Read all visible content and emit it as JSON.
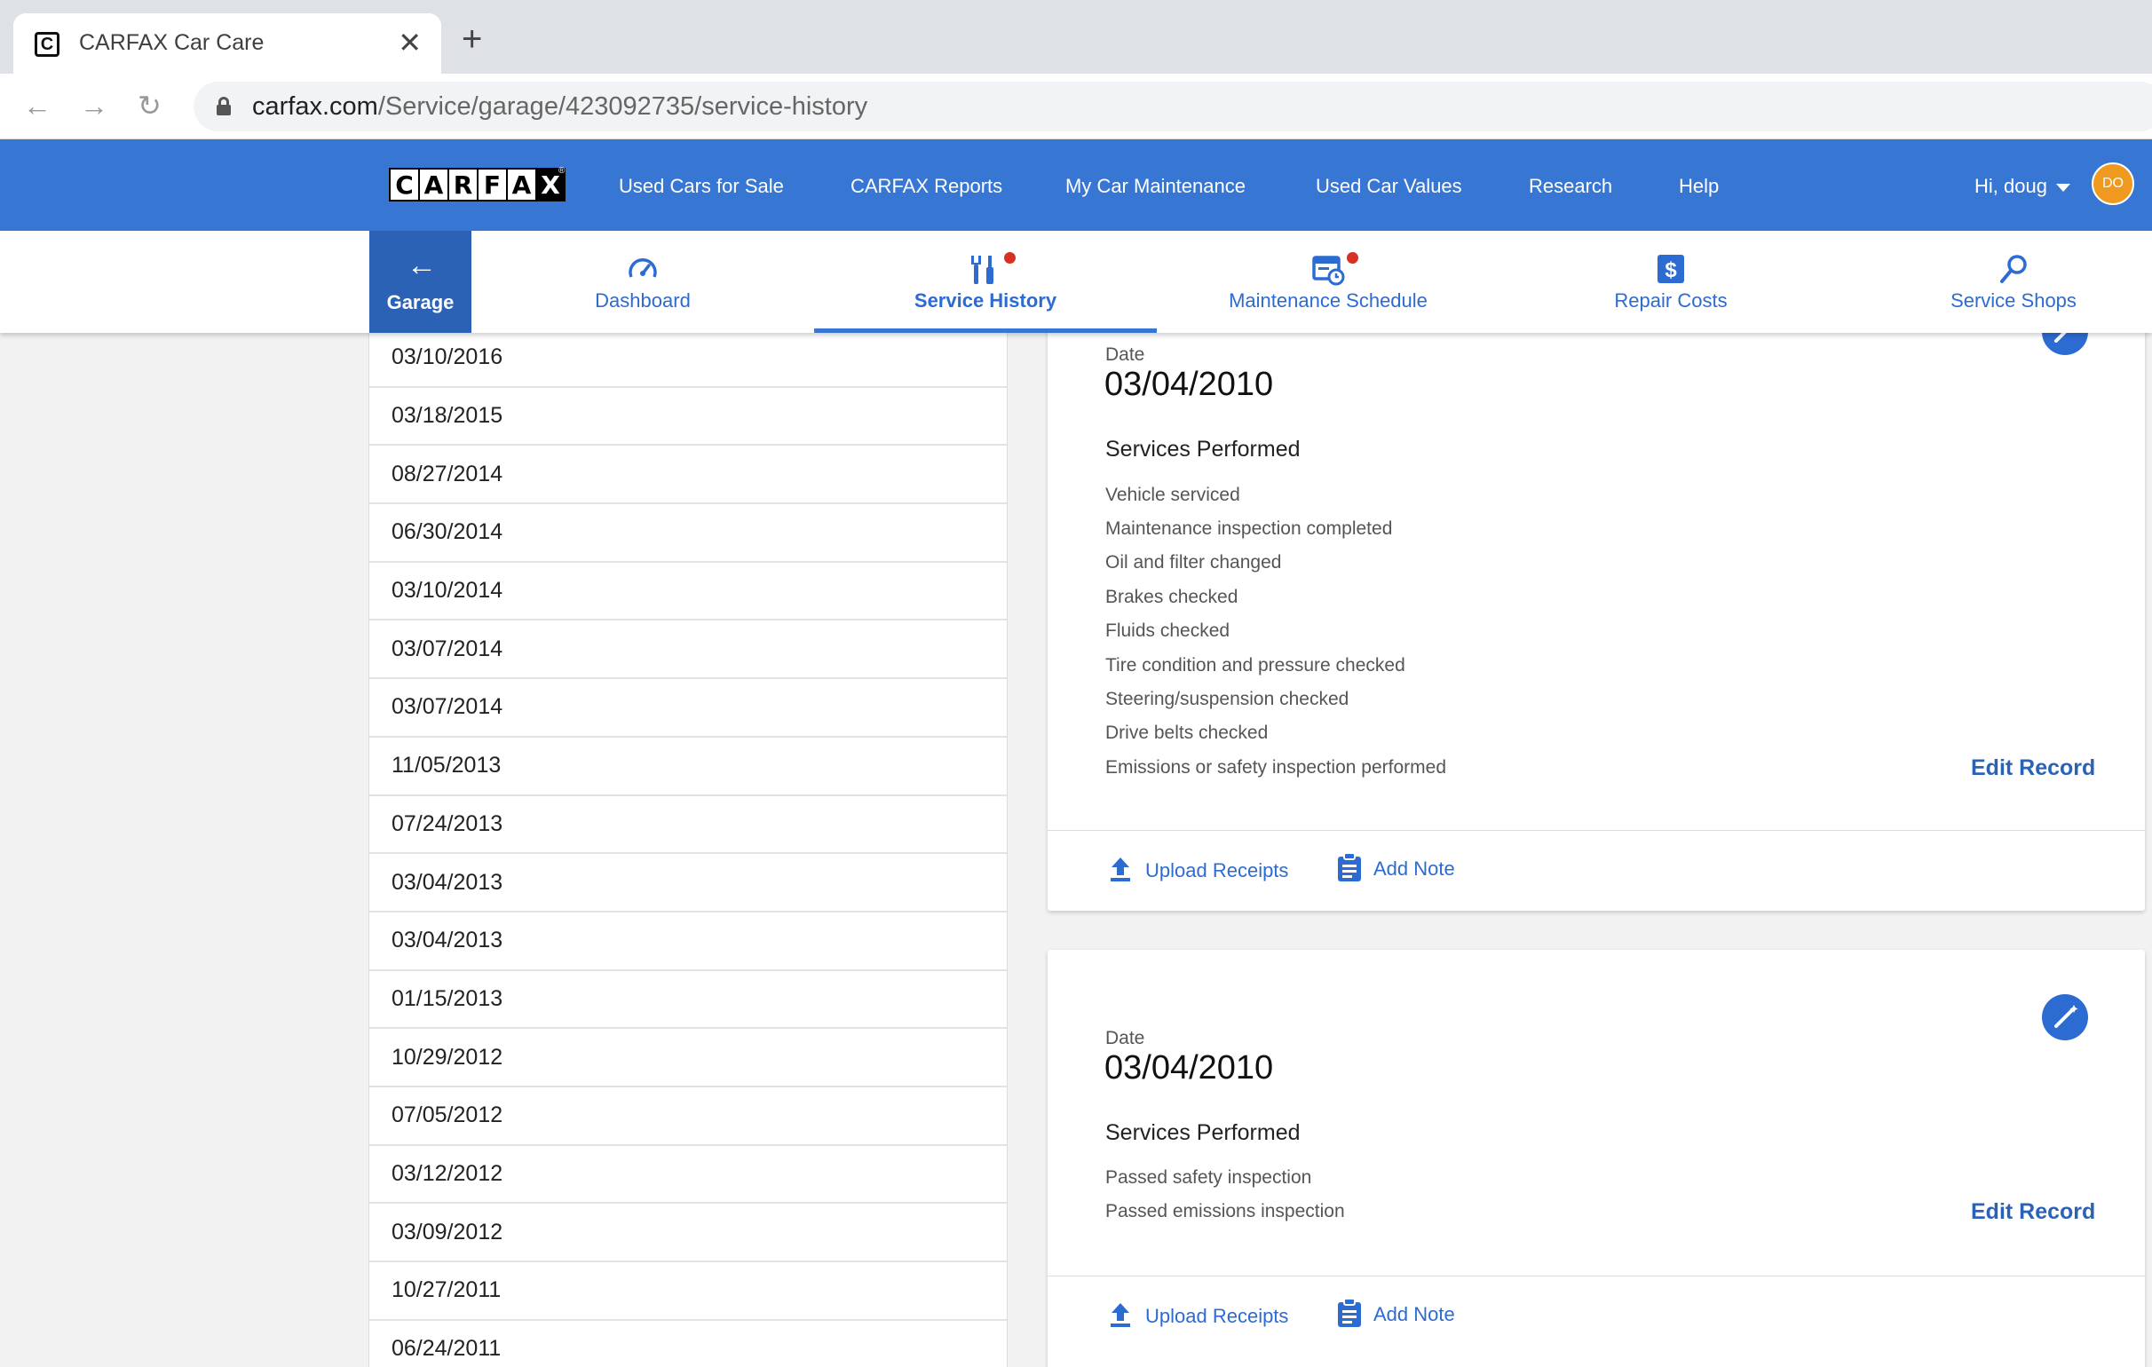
{
  "browser": {
    "tab_title": "CARFAX Car Care",
    "favicon_letter": "C",
    "tab_close": "✕",
    "new_tab": "+",
    "url_host": "carfax.com",
    "url_path": "/Service/garage/423092735/service-history",
    "back": "←",
    "forward": "→",
    "reload": "↻"
  },
  "header": {
    "logo_letters": [
      "C",
      "A",
      "R",
      "F",
      "A",
      "X"
    ],
    "logo_reg": "®",
    "nav": [
      "Used Cars for Sale",
      "CARFAX Reports",
      "My Car Maintenance",
      "Used Car Values",
      "Research",
      "Help"
    ],
    "greeting": "Hi, doug",
    "avatar_initials": "DO"
  },
  "subnav": {
    "garage_arrow": "←",
    "garage_label": "Garage",
    "items": [
      {
        "label": "Dashboard",
        "icon": "speedometer-icon",
        "active": false,
        "badge": false
      },
      {
        "label": "Service History",
        "icon": "wrench-icon",
        "active": true,
        "badge": true
      },
      {
        "label": "Maintenance Schedule",
        "icon": "calendar-clock-icon",
        "active": false,
        "badge": true
      },
      {
        "label": "Repair Costs",
        "icon": "dollar-icon",
        "active": false,
        "badge": false
      },
      {
        "label": "Service Shops",
        "icon": "search-icon",
        "active": false,
        "badge": false
      }
    ]
  },
  "date_list": [
    "03/10/2016",
    "03/18/2015",
    "08/27/2014",
    "06/30/2014",
    "03/10/2014",
    "03/07/2014",
    "03/07/2014",
    "11/05/2013",
    "07/24/2013",
    "03/04/2013",
    "03/04/2013",
    "01/15/2013",
    "10/29/2012",
    "07/05/2012",
    "03/12/2012",
    "03/09/2012",
    "10/27/2011",
    "06/24/2011"
  ],
  "records": [
    {
      "date_label": "Date",
      "date": "03/04/2010",
      "services_title": "Services Performed",
      "services": [
        "Vehicle serviced",
        "Maintenance inspection completed",
        "Oil and filter changed",
        "Brakes checked",
        "Fluids checked",
        "Tire condition and pressure checked",
        "Steering/suspension checked",
        "Drive belts checked",
        "Emissions or safety inspection performed"
      ],
      "edit_label": "Edit Record",
      "upload_label": "Upload Receipts",
      "note_label": "Add Note"
    },
    {
      "date_label": "Date",
      "date": "03/04/2010",
      "services_title": "Services Performed",
      "services": [
        "Passed safety inspection",
        "Passed emissions inspection"
      ],
      "edit_label": "Edit Record",
      "upload_label": "Upload Receipts",
      "note_label": "Add Note"
    }
  ],
  "colors": {
    "brand_blue": "#3777d3",
    "garage_blue": "#2c62b6",
    "link_blue": "#2c6bd1",
    "badge_red": "#d93025",
    "avatar_orange": "#ef9a1e"
  }
}
